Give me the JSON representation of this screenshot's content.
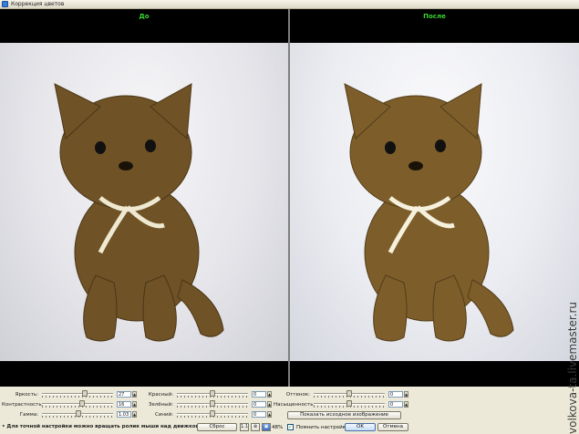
{
  "window": {
    "title": "Коррекция цветов"
  },
  "panes": {
    "before_label": "До",
    "after_label": "После"
  },
  "controls": {
    "brightness": {
      "label": "Яркость:",
      "value": "27",
      "level": 0.6
    },
    "contrast": {
      "label": "Контрастность:",
      "value": "16",
      "level": 0.56
    },
    "gamma": {
      "label": "Гамма:",
      "value": "1.03",
      "level": 0.51
    },
    "red": {
      "label": "Красный:",
      "value": "0",
      "level": 0.5
    },
    "green": {
      "label": "Зелёный:",
      "value": "0",
      "level": 0.5
    },
    "blue": {
      "label": "Синий:",
      "value": "0",
      "level": 0.5
    },
    "hue": {
      "label": "Оттенок:",
      "value": "0",
      "level": 0.5
    },
    "saturation": {
      "label": "Насыщенность:",
      "value": "0",
      "level": 0.5
    }
  },
  "buttons": {
    "show_original": "Показать исходное изображение",
    "reset": "Сброс",
    "ok": "OK",
    "cancel": "Отмена",
    "zoom_fit": "1:1"
  },
  "zoom": "48%",
  "remember_label": "Помнить настройки",
  "hint": "• Для точной настройки можно вращать ролик мыши над движком",
  "watermark": "volkova-ta.livemaster.ru",
  "colors": {
    "label_green": "#39d62f",
    "accent": "#3d6fbf"
  }
}
